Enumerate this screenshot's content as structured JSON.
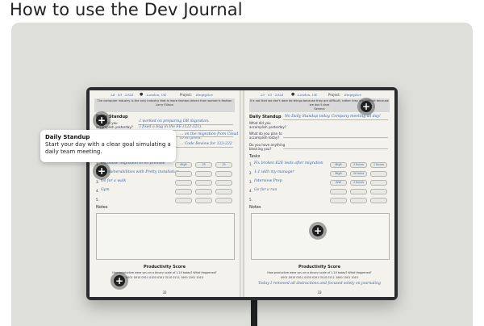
{
  "title": "How to use the Dev Journal",
  "tooltip": {
    "heading": "Daily Standup",
    "body": "Start your day with a clear goal simulating a daily team meeting."
  },
  "left": {
    "date": "24 · 03 · 2024",
    "location": "London, UK",
    "project_label": "Project:",
    "project": "EmptyDev",
    "quote": "The computer industry is the only industry that is more fashion-driven than women's fashion",
    "quote_author": "Larry Ellison",
    "standup_heading": "Daily Standup",
    "q1": "What did you accomplish yesterday?",
    "a1": "I worked on preparing DB migration.",
    "a2": "I fixed a bug in the FE (123-321).",
    "a3": "... on the migration from Cloud to on prem.",
    "a4": "... Code Review for 123-222",
    "tasks": [
      {
        "text": "Database migration to on premise",
        "p": "High",
        "t": "2h",
        "d": "2h"
      },
      {
        "text": "Fix vulnerabilities with Pretty installation",
        "p": "",
        "t": "",
        "d": ""
      },
      {
        "text": "Go for a walk",
        "p": "",
        "t": "",
        "d": ""
      },
      {
        "text": "Gym",
        "p": "",
        "t": "",
        "d": ""
      },
      {
        "text": "",
        "p": "",
        "t": "",
        "d": ""
      }
    ],
    "notes_heading": "Notes",
    "score_heading": "Productivity Score",
    "score_question": "How productive were you on a binary scale of 1-10 today? What Happened?",
    "score_scale": "0001 0010 0011 0100 0101 0110 0111 1000 1001 1010",
    "page_number": "32"
  },
  "right": {
    "date": "25 · 03 · 2024",
    "location": "London, UK",
    "project_label": "Project:",
    "project": "EmptyDev",
    "quote": "It's not that we don't dare do things because they are difficult; rather they are difficult because we don't dare",
    "quote_author": "Seneca",
    "standup_heading": "Daily Standup",
    "q1": "What did you accomplish yesterday?",
    "a1": "No Daily Standup today. Company meeting all day!",
    "q2": "What do you plan to accomplish today?",
    "q3": "Do you have anything blocking you?",
    "tasks_heading": "Tasks",
    "tasks": [
      {
        "text": "Fix broken E2E tests after migration",
        "p": "High",
        "t": "3 hours",
        "d": "2 hours"
      },
      {
        "text": "1:1 with my manager",
        "p": "High",
        "t": "30 mins",
        "d": ""
      },
      {
        "text": "Interview Prep",
        "p": "Mid",
        "t": "3 hours",
        "d": ""
      },
      {
        "text": "Go for a run",
        "p": "",
        "t": "",
        "d": ""
      },
      {
        "text": "",
        "p": "",
        "t": "",
        "d": ""
      }
    ],
    "notes_heading": "Notes",
    "score_heading": "Productivity Score",
    "score_question": "How productive were you on a binary scale of 1-10 today? What Happened?",
    "score_scale": "0001 0010 0011 0100 0101 0110 0111 1000 1001 1010",
    "score_note": "Today I removed all distractions and focused solely on journaling",
    "page_number": "33"
  },
  "hotspot_icon": "plus-icon"
}
